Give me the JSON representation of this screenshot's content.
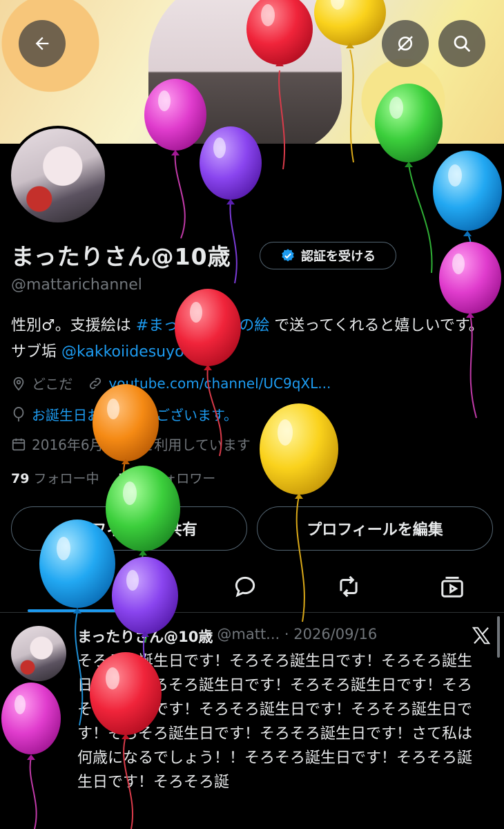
{
  "profile": {
    "display_name": "まったりさん@10歳",
    "verify_label": "認証を受ける",
    "handle": "@mattarichannel",
    "bio_part1": "性別♂。支援絵は ",
    "bio_hashtag": "#まったりさんの絵",
    "bio_part2": " で送ってくれると嬉しいです。サブ垢 ",
    "bio_mention": "@kakkoiidesuyo",
    "location": "どこだ",
    "website": "youtube.com/channel/UC9qXL...",
    "birthday_text": "お誕生日おめでとうございます。",
    "joined": "2016年6月からXを利用しています",
    "following_count": "79",
    "following_label": "フォロー中",
    "followers_count": "777",
    "followers_label": "フォロワー"
  },
  "actions": {
    "share_profile": "プロフィールを共有",
    "edit_profile": "プロフィールを編集"
  },
  "tweet": {
    "name": "まったりさん@10歳",
    "handle_date": "@matt... · 2026/09/16",
    "text": "そろそろ誕生日です！そろそろ誕生日です！そろそろ誕生日です！そろそろ誕生日です！そろそろ誕生日です！そろそろ誕生日です！そろそろ誕生日です！そろそろ誕生日です！そろそろ誕生日です！そろそろ誕生日です！さて私は何歳になるでしょう！！そろそろ誕生日です！そろそろ誕生日です！そろそろ誕"
  },
  "icons": [
    "back-arrow-icon",
    "no-notify-icon",
    "search-icon",
    "verified-check-icon",
    "location-icon",
    "link-icon",
    "balloon-icon",
    "calendar-icon",
    "reply-icon",
    "retweet-icon",
    "media-icon",
    "x-logo-icon"
  ],
  "colors": {
    "accent": "#1d9bf0",
    "muted": "#71767b",
    "text": "#e7e9ea",
    "background": "#000000"
  }
}
